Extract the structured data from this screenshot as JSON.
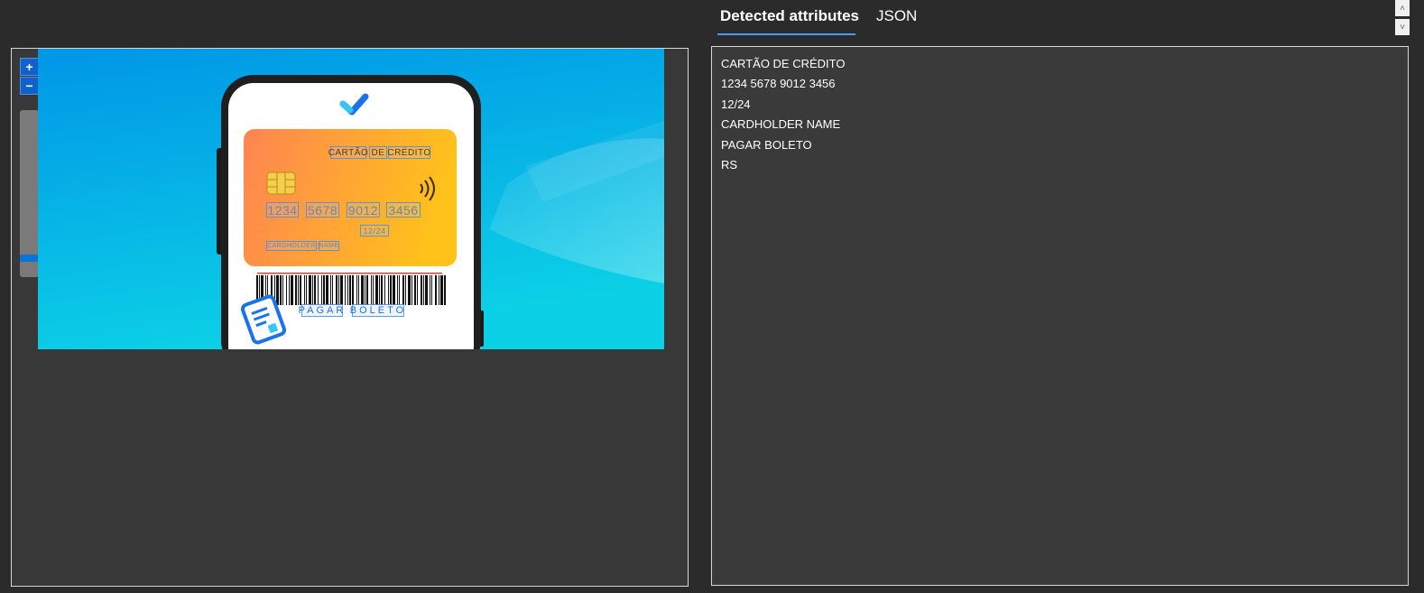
{
  "tabs": [
    {
      "label": "Detected attributes",
      "active": true
    },
    {
      "label": "JSON",
      "active": false
    }
  ],
  "zoom": {
    "in_label": "+",
    "out_label": "−"
  },
  "scrollbar": {
    "up_glyph": "˄",
    "down_glyph": "˅"
  },
  "image": {
    "card": {
      "title": "CARTÃO DE CRÉDITO",
      "number": "1234 5678 9012 3456",
      "expiry": "12/24",
      "holder": "CARDHOLDER NAME"
    },
    "bill_label": "PAGAR BOLETO"
  },
  "attributes": [
    "CARTÃO DE CRÉDITO",
    "1234 5678 9012 3456",
    "12/24",
    "CARDHOLDER NAME",
    "PAGAR BOLETO",
    "RS"
  ],
  "colors": {
    "accent": "#4a9bf0",
    "zoom_button": "#0f62c9",
    "panel_bg": "#3a3a3a",
    "page_bg": "#2b2b2b"
  }
}
